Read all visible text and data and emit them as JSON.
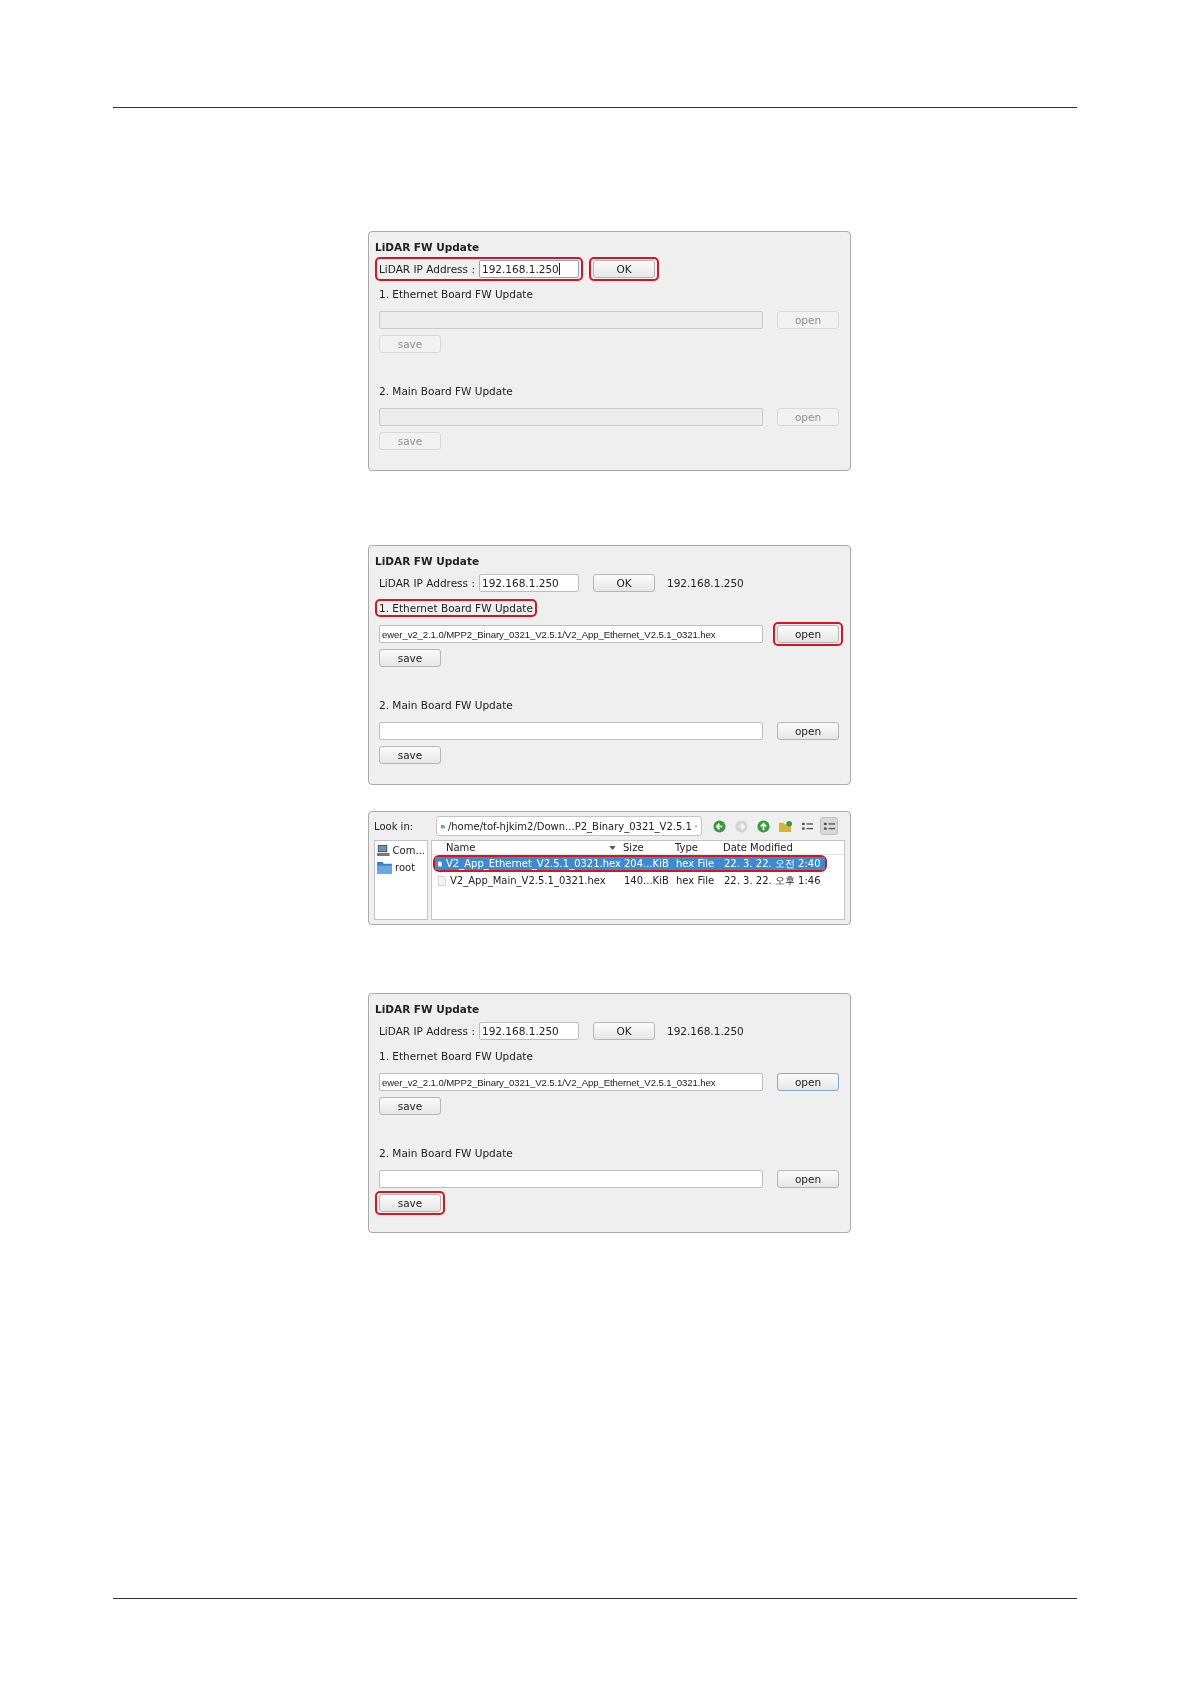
{
  "panels": [
    {
      "kind": "update_panel",
      "title": "LiDAR FW Update",
      "ip": {
        "label": "LiDAR IP Address :",
        "value": "192.168.1.250",
        "highlighted": true,
        "focused": true
      },
      "ok_button": {
        "label": "OK",
        "highlighted": true
      },
      "sections": [
        {
          "heading": "1. Ethernet Board FW Update",
          "heading_highlighted": false,
          "disabled": true,
          "open_label": "open",
          "open_highlighted": false,
          "open_focused": false,
          "save_label": "save",
          "save_highlighted": false
        },
        {
          "heading": "2. Main Board FW Update",
          "heading_highlighted": false,
          "disabled": true,
          "open_label": "open",
          "open_highlighted": false,
          "open_focused": false,
          "save_label": "save",
          "save_highlighted": false
        }
      ]
    },
    {
      "kind": "update_panel",
      "title": "LiDAR FW Update",
      "ip": {
        "label": "LiDAR IP Address :",
        "value": "192.168.1.250",
        "highlighted": false,
        "focused": false
      },
      "ok_button": {
        "label": "OK",
        "highlighted": false
      },
      "ip_status": "192.168.1.250",
      "sections": [
        {
          "heading": "1. Ethernet Board FW Update",
          "heading_highlighted": true,
          "path": "ewer_v2_2.1.0/MPP2_Binary_0321_V2.5.1/V2_App_Ethernet_V2.5.1_0321.hex",
          "disabled": false,
          "open_label": "open",
          "open_highlighted": true,
          "open_focused": false,
          "save_label": "save",
          "save_highlighted": false
        },
        {
          "heading": "2. Main Board FW Update",
          "heading_highlighted": false,
          "disabled": false,
          "open_label": "open",
          "open_highlighted": false,
          "open_focused": false,
          "save_label": "save",
          "save_highlighted": false
        }
      ]
    },
    {
      "kind": "file_dialog",
      "look_in_label": "Look in:",
      "location": "/home/tof-hjkim2/Down...P2_Binary_0321_V2.5.1",
      "toolbar": [
        {
          "kind": "back",
          "disabled": false,
          "selected": false
        },
        {
          "kind": "forward",
          "disabled": true,
          "selected": false
        },
        {
          "kind": "up",
          "disabled": false,
          "selected": false
        },
        {
          "kind": "new_folder",
          "disabled": false,
          "selected": false
        },
        {
          "kind": "list_view",
          "disabled": false,
          "selected": false
        },
        {
          "kind": "detail_view",
          "disabled": false,
          "selected": true
        }
      ],
      "sidebar": [
        {
          "kind": "computer",
          "label": "Com..."
        },
        {
          "kind": "folder",
          "label": "root"
        }
      ],
      "columns": [
        {
          "label": "Name",
          "sorted": true
        },
        {
          "label": "Size",
          "sorted": false
        },
        {
          "label": "Type",
          "sorted": false
        },
        {
          "label": "Date Modified",
          "sorted": false
        }
      ],
      "rows": [
        {
          "name": "V2_App_Ethernet_V2.5.1_0321.hex",
          "size": "204...KiB",
          "type": "hex File",
          "modified": "22. 3. 22. 오전 2:40",
          "selected": true,
          "highlighted": true
        },
        {
          "name": "V2_App_Main_V2.5.1_0321.hex",
          "size": "140...KiB",
          "type": "hex File",
          "modified": "22. 3. 22. 오후 1:46",
          "selected": false,
          "highlighted": false
        }
      ]
    },
    {
      "kind": "update_panel",
      "title": "LiDAR FW Update",
      "ip": {
        "label": "LiDAR IP Address :",
        "value": "192.168.1.250",
        "highlighted": false,
        "focused": false
      },
      "ok_button": {
        "label": "OK",
        "highlighted": false
      },
      "ip_status": "192.168.1.250",
      "sections": [
        {
          "heading": "1. Ethernet Board FW Update",
          "heading_highlighted": false,
          "path": "ewer_v2_2.1.0/MPP2_Binary_0321_V2.5.1/V2_App_Ethernet_V2.5.1_0321.hex",
          "disabled": false,
          "open_label": "open",
          "open_highlighted": false,
          "open_focused": true,
          "save_label": "save",
          "save_highlighted": false
        },
        {
          "heading": "2. Main Board FW Update",
          "heading_highlighted": false,
          "disabled": false,
          "open_label": "open",
          "open_highlighted": false,
          "open_focused": false,
          "save_label": "save",
          "save_highlighted": true
        }
      ]
    }
  ]
}
